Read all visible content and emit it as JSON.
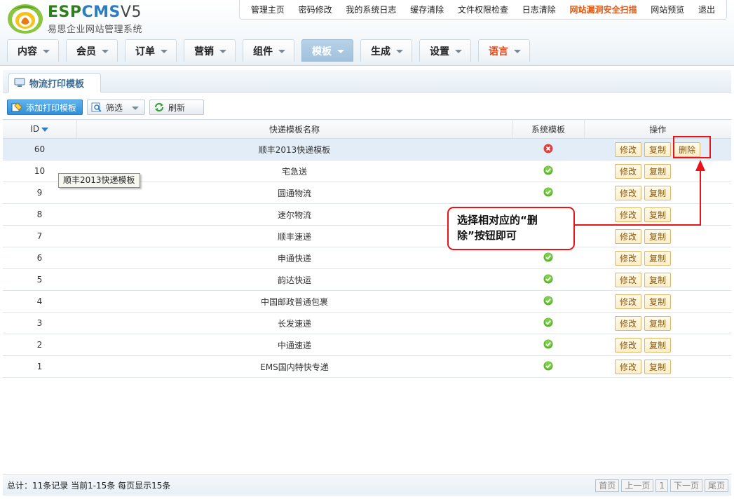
{
  "brand": {
    "logo_esp": "ESP",
    "logo_cms": "CMS",
    "logo_ver": "V5",
    "subtitle": "易思企业网站管理系统"
  },
  "top_links": [
    {
      "label": "管理主页"
    },
    {
      "label": "密码修改"
    },
    {
      "label": "我的系统日志"
    },
    {
      "label": "缓存清除"
    },
    {
      "label": "文件权限检查"
    },
    {
      "label": "日志清除"
    },
    {
      "label": "网站漏洞安全扫描",
      "highlight": true
    },
    {
      "label": "网站预览"
    },
    {
      "label": "退出"
    }
  ],
  "main_nav": [
    {
      "label": "内容"
    },
    {
      "label": "会员"
    },
    {
      "label": "订单"
    },
    {
      "label": "营销"
    },
    {
      "label": "组件"
    },
    {
      "label": "模板",
      "active": true
    },
    {
      "label": "生成"
    },
    {
      "label": "设置"
    },
    {
      "label": "语言",
      "accent": true
    }
  ],
  "section_tab": {
    "label": "物流打印模板"
  },
  "toolbar": {
    "add_label": "添加打印模板",
    "filter_label": "筛选",
    "refresh_label": "刷新"
  },
  "table": {
    "columns": {
      "id": "ID",
      "name": "快递模板名称",
      "system": "系统模板",
      "ops": "操作"
    },
    "actions": {
      "edit": "修改",
      "copy": "复制",
      "delete": "删除"
    },
    "rows": [
      {
        "id": "60",
        "name": "顺丰2013快递模板",
        "system": false,
        "selected": true
      },
      {
        "id": "10",
        "name": "宅急送",
        "system": true
      },
      {
        "id": "9",
        "name": "圆通物流",
        "system": true
      },
      {
        "id": "8",
        "name": "速尔物流",
        "system": true
      },
      {
        "id": "7",
        "name": "顺丰速递",
        "system": true
      },
      {
        "id": "6",
        "name": "申通快递",
        "system": true
      },
      {
        "id": "5",
        "name": "韵达快运",
        "system": true
      },
      {
        "id": "4",
        "name": "中国邮政普通包裹",
        "system": true
      },
      {
        "id": "3",
        "name": "长发速递",
        "system": true
      },
      {
        "id": "2",
        "name": "中通速递",
        "system": true
      },
      {
        "id": "1",
        "name": "EMS国内特快专递",
        "system": true
      }
    ]
  },
  "tooltip": {
    "text": "顺丰2013快递模板"
  },
  "callout": {
    "text": "选择相对应的“删除”按钮即可"
  },
  "footer": {
    "summary": "总计：11条记录 当前1-15条 每页显示15条",
    "pager": {
      "first": "首页",
      "prev": "上一页",
      "page": "1",
      "next": "下一页",
      "last": "尾页"
    }
  },
  "colors": {
    "accent": "#2d7dc6",
    "warning": "#e05a14",
    "annotation": "#e8141a",
    "yes": "#5ab52a",
    "no": "#e0413c"
  }
}
